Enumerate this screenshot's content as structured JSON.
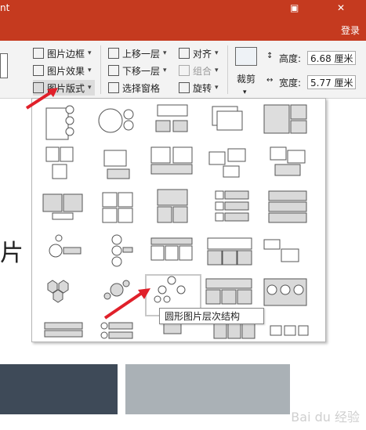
{
  "titlebar": {
    "title_fragment": "nt",
    "restore_glyph": "▣",
    "close_glyph": "✕",
    "bg": "#c53a1f"
  },
  "login": {
    "label": "登录"
  },
  "ribbon": {
    "picture_border": "图片边框",
    "picture_effects": "图片效果",
    "picture_layout": "图片版式",
    "bring_forward": "上移一层",
    "send_backward": "下移一层",
    "selection_pane": "选择窗格",
    "align": "对齐",
    "group": "组合",
    "rotate": "旋转",
    "crop": "裁剪",
    "height_label": "高度:",
    "height_value": "6.68 厘米",
    "width_label": "宽度:",
    "width_value": "5.77 厘米",
    "dropdown_glyph": "▾"
  },
  "slide": {
    "text_fragment": "片",
    "watermark": "Bai du 经验"
  },
  "gallery": {
    "selected_index": 21,
    "tooltip": "圆形图片层次结构",
    "item_count": 30
  },
  "colors": {
    "accent": "#c53a1f",
    "arrow": "#e0202a"
  }
}
